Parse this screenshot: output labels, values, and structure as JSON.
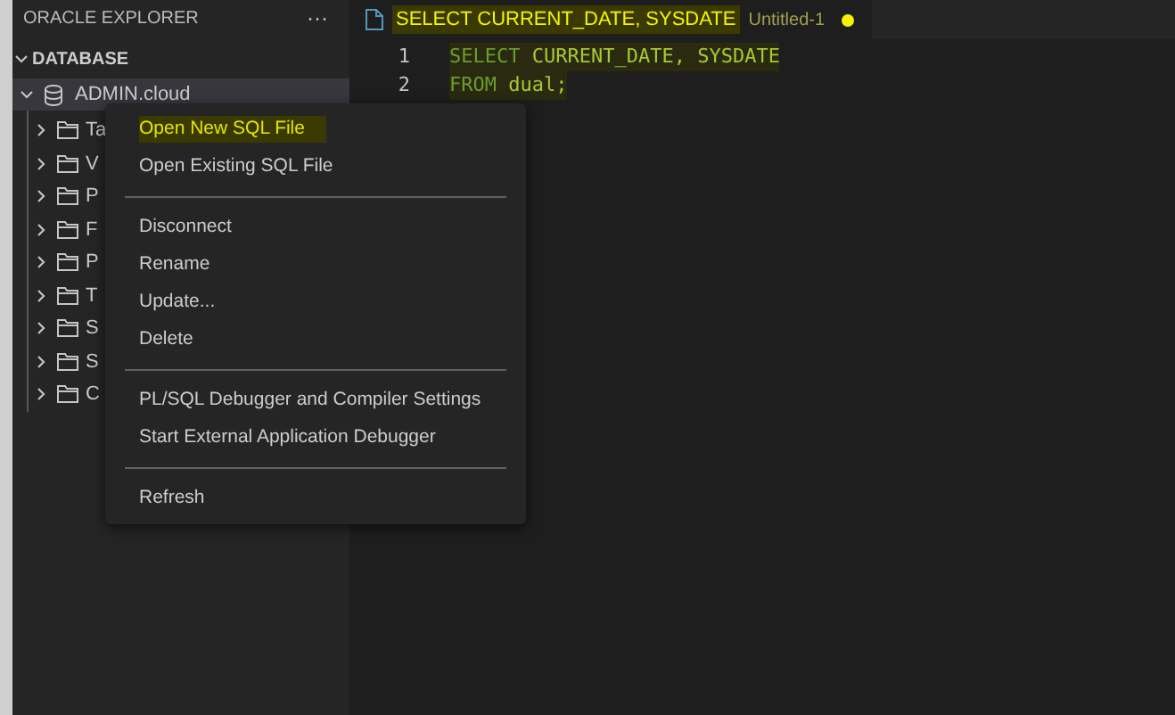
{
  "sidebar": {
    "title": "ORACLE EXPLORER",
    "more": "···",
    "section": {
      "label": "DATABASE",
      "expanded": true
    },
    "connection": {
      "label": "ADMIN.cloud",
      "expanded": true,
      "children": [
        {
          "label": "Ta",
          "expanded": false
        },
        {
          "label": "V",
          "expanded": false
        },
        {
          "label": "P",
          "expanded": false
        },
        {
          "label": "F",
          "expanded": false
        },
        {
          "label": "P",
          "expanded": false
        },
        {
          "label": "T",
          "expanded": false
        },
        {
          "label": "S",
          "expanded": false
        },
        {
          "label": "S",
          "expanded": false
        },
        {
          "label": "C",
          "expanded": false
        }
      ]
    }
  },
  "tab": {
    "title": "SELECT CURRENT_DATE, SYSDATE",
    "file": "Untitled-1",
    "dirty": true
  },
  "editor": {
    "lines": [
      {
        "number": "1",
        "tokens": [
          {
            "kind": "keyword",
            "text": "SELECT"
          },
          {
            "kind": "plain",
            "text": " CURRENT_DATE, SYSDATE"
          }
        ]
      },
      {
        "number": "2",
        "tokens": [
          {
            "kind": "keyword",
            "text": "FROM"
          },
          {
            "kind": "plain",
            "text": " dual;"
          }
        ]
      }
    ]
  },
  "context_menu": {
    "groups": [
      [
        {
          "label": "Open New SQL File",
          "selected": true
        },
        {
          "label": "Open Existing SQL File",
          "selected": false
        }
      ],
      [
        {
          "label": "Disconnect",
          "selected": false
        },
        {
          "label": "Rename",
          "selected": false
        },
        {
          "label": "Update...",
          "selected": false
        },
        {
          "label": "Delete",
          "selected": false
        }
      ],
      [
        {
          "label": "PL/SQL Debugger and Compiler Settings",
          "selected": false
        },
        {
          "label": "Start External Application Debugger",
          "selected": false
        }
      ],
      [
        {
          "label": "Refresh",
          "selected": false
        }
      ]
    ]
  }
}
